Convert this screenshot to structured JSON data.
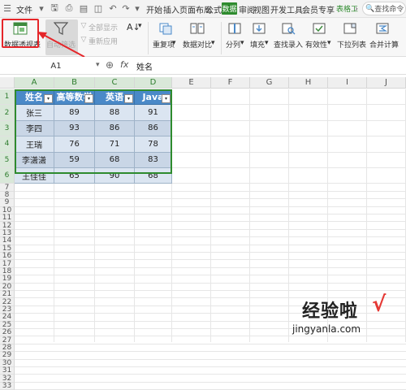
{
  "menubar": {
    "file_label": "文件",
    "tabs": [
      "开始",
      "插入",
      "页面布局",
      "公式",
      "数据",
      "审阅",
      "视图",
      "开发工具",
      "会员专享",
      "表格工"
    ],
    "search_label": "查找命令"
  },
  "ribbon": {
    "pivot_table": "数据透视表",
    "auto_filter": "自动筛选",
    "show_all": "全部显示",
    "reapply": "重新应用",
    "sort": "A↓",
    "duplicates": "重复项",
    "data_compare": "数据对比",
    "split_column": "分列",
    "fill": "填充",
    "find_entry": "查找录入",
    "validity": "有效性",
    "dropdown_list": "下拉列表",
    "merge_calc": "合并计算"
  },
  "formula": {
    "cell_ref": "A1",
    "zoom_icon": "⊕",
    "fx": "fx",
    "value": "姓名"
  },
  "columns": [
    "A",
    "B",
    "C",
    "D",
    "E",
    "F",
    "G",
    "H",
    "I",
    "J"
  ],
  "rows": [
    "1",
    "2",
    "3",
    "4",
    "5",
    "6",
    "7",
    "8",
    "9",
    "10",
    "11",
    "12",
    "13",
    "14",
    "15",
    "16",
    "17",
    "18",
    "19",
    "20",
    "21",
    "22",
    "23",
    "24",
    "25",
    "26",
    "27",
    "28",
    "29",
    "30",
    "31",
    "32",
    "33"
  ],
  "table": {
    "headers": [
      "姓名",
      "高等数学",
      "英语",
      "Java"
    ],
    "rows": [
      [
        "张三",
        "89",
        "88",
        "91"
      ],
      [
        "李四",
        "93",
        "86",
        "86"
      ],
      [
        "王瑞",
        "76",
        "71",
        "78"
      ],
      [
        "李潇潇",
        "59",
        "68",
        "83"
      ],
      [
        "王佳佳",
        "65",
        "90",
        "68"
      ]
    ]
  },
  "watermark": {
    "brand": "经验啦",
    "check": "√",
    "url": "jingyanla.com"
  }
}
